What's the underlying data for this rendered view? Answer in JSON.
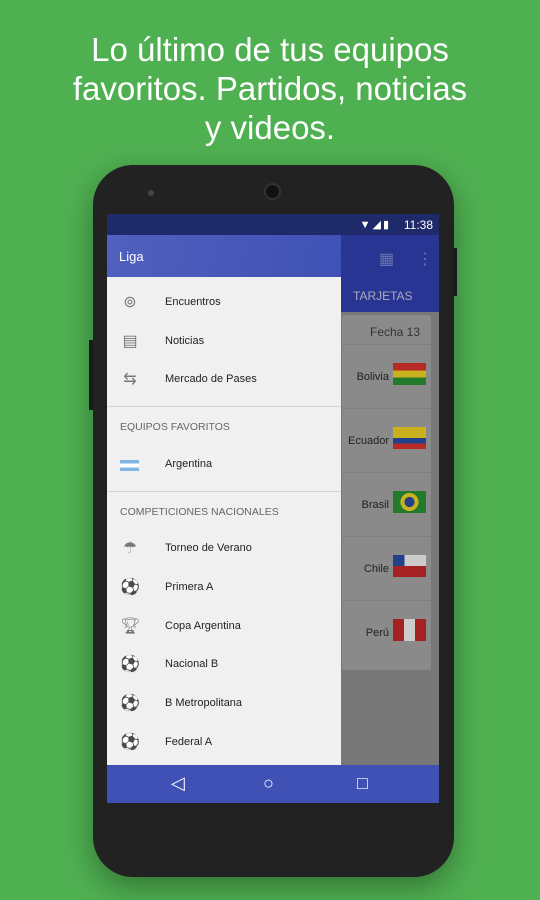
{
  "headline": [
    "Lo último de tus equipos",
    "favoritos. Partidos, noticias",
    "y videos."
  ],
  "status": {
    "time": "11:38",
    "icons": "▼◢▮"
  },
  "toolbar": {
    "calendar_icon": "▦",
    "menu_icon": "⋮"
  },
  "tabs": {
    "active": "TARJETAS"
  },
  "card": {
    "header": "Fecha 13",
    "rows": [
      "Bolivia",
      "Ecuador",
      "Brasil",
      "Chile",
      "Perú"
    ]
  },
  "drawer": {
    "title": "Liga",
    "main_items": [
      "Encuentros",
      "Noticias",
      "Mercado de Pases"
    ],
    "fav_header": "EQUIPOS FAVORITOS",
    "fav_items": [
      "Argentina"
    ],
    "comp_header": "COMPETICIONES NACIONALES",
    "comp_items": [
      "Torneo de Verano",
      "Primera A",
      "Copa Argentina",
      "Nacional B",
      "B Metropolitana",
      "Federal A"
    ]
  },
  "nav": {
    "back": "◁",
    "home": "○",
    "recent": "□"
  },
  "colors": {
    "background": "#4fb051",
    "primary": "#3f51b5",
    "primary_dark": "#283593"
  }
}
